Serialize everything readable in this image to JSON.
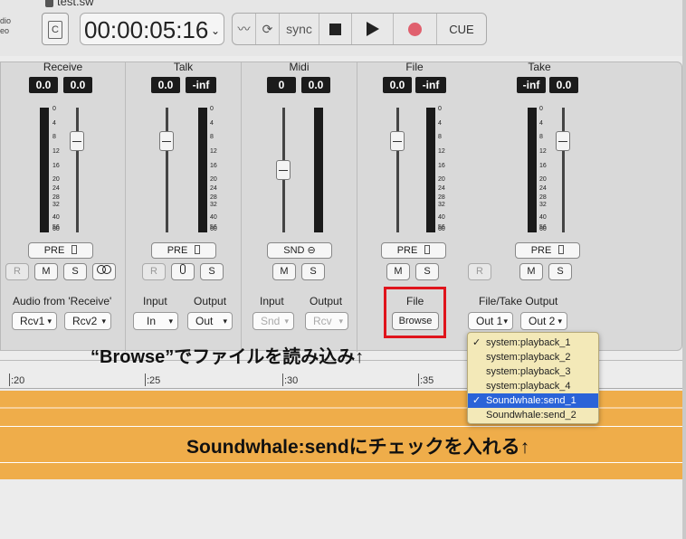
{
  "topbar": {
    "filename": "test.sw",
    "io_label_1": "dio",
    "io_label_2": "eo",
    "c_glyph": "C",
    "timecode": "00:00:05:16",
    "transport": {
      "sync": "sync",
      "cue": "CUE"
    }
  },
  "strips": {
    "receive": {
      "title": "Receive",
      "val_left": "0.0",
      "val_right": "0.0",
      "pre": "PRE",
      "r": "R",
      "m": "M",
      "s": "S",
      "io_title": "Audio from 'Receive'",
      "sel1": "Rcv1",
      "sel2": "Rcv2"
    },
    "talk": {
      "title": "Talk",
      "val_left": "0.0",
      "val_right": "-inf",
      "pre": "PRE",
      "r": "R",
      "s": "S",
      "input_label": "Input",
      "output_label": "Output",
      "sel_in": "In",
      "sel_out": "Out"
    },
    "midi": {
      "title": "Midi",
      "val_left": "0",
      "val_right": "0.0",
      "snd": "SND",
      "m": "M",
      "s": "S",
      "input_label": "Input",
      "output_label": "Output",
      "sel_in": "Snd",
      "sel_out": "Rcv"
    },
    "file": {
      "title": "File",
      "val_left": "0.0",
      "val_right": "-inf",
      "pre": "PRE",
      "m": "M",
      "s": "S",
      "file_label": "File",
      "browse": "Browse"
    },
    "take": {
      "title": "Take",
      "val_left": "-inf",
      "val_right": "0.0",
      "pre": "PRE",
      "r": "R",
      "m": "M",
      "s": "S",
      "output_label": "File/Take Output",
      "sel1": "Out 1",
      "sel2": "Out 2"
    }
  },
  "scale_marks": [
    "0",
    "4",
    "8",
    "12",
    "16",
    "20",
    "24",
    "28",
    "32",
    "40",
    "56",
    "60"
  ],
  "ruler": [
    ":20",
    ":25",
    ":30",
    ":35"
  ],
  "dropdown": {
    "items": [
      {
        "label": "system:playback_1",
        "checked": true,
        "selected": false
      },
      {
        "label": "system:playback_2",
        "checked": false,
        "selected": false
      },
      {
        "label": "system:playback_3",
        "checked": false,
        "selected": false
      },
      {
        "label": "system:playback_4",
        "checked": false,
        "selected": false
      },
      {
        "label": "Soundwhale:send_1",
        "checked": true,
        "selected": true
      },
      {
        "label": "Soundwhale:send_2",
        "checked": false,
        "selected": false
      }
    ]
  },
  "annotations": {
    "browse_note": "“Browse”でファイルを読み込み↑",
    "send_note": "Soundwhale:sendにチェックを入れる↑"
  },
  "colors": {
    "waveform": "#efad4a",
    "highlight": "#e0141c",
    "record": "#e0606e",
    "menu_selection": "#2a63d8"
  }
}
